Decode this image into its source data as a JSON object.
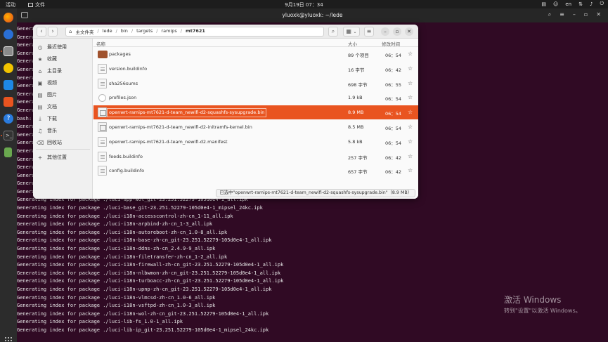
{
  "topbar": {
    "activities": "活动",
    "app_menu": "文件",
    "clock": "9月19日  07：34",
    "lang": "en"
  },
  "terminal": {
    "title": "yluoxk@yluoxk: ~/lede",
    "lines": [
      "Genera",
      "Genera",
      "Genera",
      "Genera",
      "Genera",
      "Genera",
      "Genera",
      "Genera",
      "Genera",
      "Genera",
      "Genera",
      "bash:",
      "Genera",
      "Genera",
      "Genera",
      "Genera",
      "Genera",
      "Genera",
      "Genera",
      "Genera",
      "Generating index for package ./luci-app-vsftpd_1.0-3_all.ipk",
      "Generating index for package ./luci-app-wol_git-23.251.52279-105d0e4-1_all.ipk",
      "Generating index for package ./luci-base_git-23.251.52279-105d0e4-1_mipsel_24kc.ipk",
      "Generating index for package ./luci-i18n-accesscontrol-zh-cn_1-11_all.ipk",
      "Generating index for package ./luci-i18n-arpbind-zh-cn_1-3_all.ipk",
      "Generating index for package ./luci-i18n-autoreboot-zh-cn_1.0-8_all.ipk",
      "Generating index for package ./luci-i18n-base-zh-cn_git-23.251.52279-105d0e4-1_all.ipk",
      "Generating index for package ./luci-i18n-ddns-zh-cn_2.4.9-9_all.ipk",
      "Generating index for package ./luci-i18n-filetransfer-zh-cn_1-2_all.ipk",
      "Generating index for package ./luci-i18n-firewall-zh-cn_git-23.251.52279-105d0e4-1_all.ipk",
      "Generating index for package ./luci-i18n-nlbwmon-zh-cn_git-23.251.52279-105d0e4-1_all.ipk",
      "Generating index for package ./luci-i18n-turboacc-zh-cn_git-23.251.52279-105d0e4-1_all.ipk",
      "Generating index for package ./luci-i18n-upnp-zh-cn_git-23.251.52279-105d0e4-1_all.ipk",
      "Generating index for package ./luci-i18n-vlmcsd-zh-cn_1.0-6_all.ipk",
      "Generating index for package ./luci-i18n-vsftpd-zh-cn_1.0-3_all.ipk",
      "Generating index for package ./luci-i18n-wol-zh-cn_git-23.251.52279-105d0e4-1_all.ipk",
      "Generating index for package ./luci-lib-fs_1.0-1_all.ipk",
      "Generating index for package ./luci-lib-ip_git-23.251.52279-105d0e4-1_mipsel_24kc.ipk"
    ],
    "watermark_title": "激活 Windows",
    "watermark_sub": "转到\"设置\"以激活 Windows。"
  },
  "file_manager": {
    "path": [
      "主文件夹",
      "lede",
      "bin",
      "targets",
      "ramips",
      "mt7621"
    ],
    "sidebar": [
      {
        "icon": "clock-icon",
        "label": "最近使用"
      },
      {
        "icon": "star-icon",
        "label": "收藏"
      },
      {
        "icon": "home-icon",
        "label": "主目录"
      },
      {
        "icon": "video-icon",
        "label": "视频"
      },
      {
        "icon": "picture-icon",
        "label": "图片"
      },
      {
        "icon": "document-icon",
        "label": "文档"
      },
      {
        "icon": "download-icon",
        "label": "下载"
      },
      {
        "icon": "music-icon",
        "label": "音乐"
      },
      {
        "icon": "trash-icon",
        "label": "回收站"
      },
      {
        "icon": "plus-icon",
        "label": "其他位置"
      }
    ],
    "columns": {
      "name": "名称",
      "size": "大小",
      "modified": "修改时间"
    },
    "files": [
      {
        "name": "packages",
        "size": "89 个项目",
        "time": "06：54",
        "type": "folder"
      },
      {
        "name": "version.buildinfo",
        "size": "16 字节",
        "time": "06：42",
        "type": "doc"
      },
      {
        "name": "sha256sums",
        "size": "698 字节",
        "time": "06：55",
        "type": "doc"
      },
      {
        "name": "profiles.json",
        "size": "1.9 kB",
        "time": "06：54",
        "type": "json"
      },
      {
        "name": "openwrt-ramips-mt7621-d-team_newifi-d2-squashfs-sysupgrade.bin",
        "size": "8.9 MB",
        "time": "06：54",
        "type": "bin",
        "selected": true
      },
      {
        "name": "openwrt-ramips-mt7621-d-team_newifi-d2-initramfs-kernel.bin",
        "size": "8.5 MB",
        "time": "06：54",
        "type": "bin"
      },
      {
        "name": "openwrt-ramips-mt7621-d-team_newifi-d2.manifest",
        "size": "5.8 kB",
        "time": "06：54",
        "type": "doc"
      },
      {
        "name": "feeds.buildinfo",
        "size": "257 字节",
        "time": "06：42",
        "type": "doc"
      },
      {
        "name": "config.buildinfo",
        "size": "657 字节",
        "time": "06：42",
        "type": "doc"
      }
    ],
    "status": "已选中\"openwrt-ramips-mt7621-d-team_newifi-d2-squashfs-sysupgrade.bin\"（8.9 MB）"
  },
  "colors": {
    "accent": "#e95420",
    "terminal_bg": "#300a24"
  }
}
